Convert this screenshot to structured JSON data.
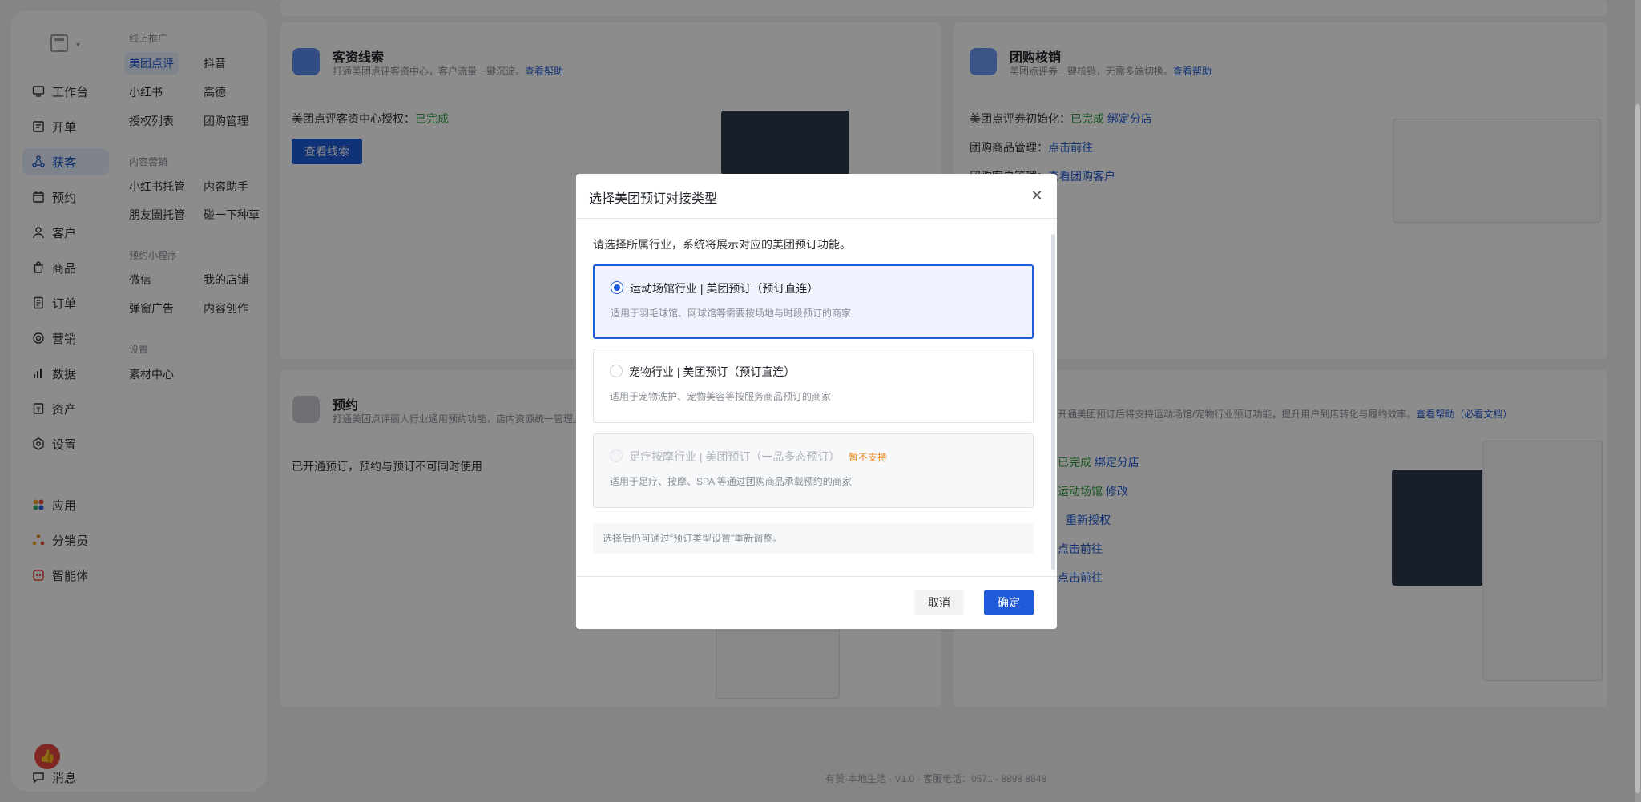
{
  "sidebar": {
    "primary": [
      {
        "label": "工作台",
        "icon": "monitor-icon"
      },
      {
        "label": "开单",
        "icon": "cashier-icon"
      },
      {
        "label": "获客",
        "icon": "share-icon"
      },
      {
        "label": "预约",
        "icon": "calendar-icon"
      },
      {
        "label": "客户",
        "icon": "user-icon"
      },
      {
        "label": "商品",
        "icon": "bag-icon"
      },
      {
        "label": "订单",
        "icon": "order-icon"
      },
      {
        "label": "营销",
        "icon": "marketing-icon"
      },
      {
        "label": "数据",
        "icon": "chart-icon"
      },
      {
        "label": "资产",
        "icon": "asset-icon"
      },
      {
        "label": "设置",
        "icon": "gear-icon"
      },
      {
        "label": "应用",
        "icon": "apps-icon"
      },
      {
        "label": "分销员",
        "icon": "distributor-icon"
      },
      {
        "label": "智能体",
        "icon": "agent-icon"
      },
      {
        "label": "消息",
        "icon": "message-icon"
      }
    ],
    "sections": [
      {
        "title": "线上推广",
        "items": [
          "美团点评",
          "抖音",
          "小红书",
          "高德",
          "授权列表",
          "团购管理"
        ]
      },
      {
        "title": "内容营销",
        "items": [
          "小红书托管",
          "内容助手",
          "朋友圈托管",
          "碰一下种草"
        ]
      },
      {
        "title": "预约小程序",
        "items": [
          "微信",
          "我的店铺",
          "弹窗广告",
          "内容创作"
        ]
      },
      {
        "title": "设置",
        "items": [
          "素材中心"
        ]
      }
    ]
  },
  "cards": {
    "leads": {
      "title": "客资线索",
      "desc": "打通美团点评客资中心，客户流量一键沉淀。",
      "help": "查看帮助",
      "auth_label": "美团点评客资中心授权：",
      "auth_status": "已完成",
      "button": "查看线索"
    },
    "groupbuy": {
      "title": "团购核销",
      "desc": "美团点评券一键核销，无需多端切换。",
      "help": "查看帮助",
      "init_label": "美团点评券初始化：",
      "init_status": "已完成",
      "init_link": "绑定分店",
      "goods_label": "团购商品管理：",
      "goods_link": "点击前往",
      "customer_label": "团购客户管理：",
      "customer_link": "查看团购客户"
    },
    "booking": {
      "title": "预约",
      "desc": "打通美团点评丽人行业通用预约功能，店内资源统一管理。",
      "note": "已开通预订，预约与预订不可同时使用"
    },
    "reserve": {
      "desc": "开通美团预订后将支持运动场馆/宠物行业预订功能，提升用户到店转化与履约效率。",
      "help": "查看帮助（必看文档）",
      "status": "已完成",
      "status_link": "绑定分店",
      "type_value": "运动场馆",
      "type_link": "修改",
      "auth_link": "重新授权",
      "link1": "点击前往",
      "link2": "点击前往"
    }
  },
  "footer": "有赞·本地生活 · V1.0 · 客服电话：0571 - 8898 8848",
  "modal": {
    "title": "选择美团预订对接类型",
    "intro": "请选择所属行业，系统将展示对应的美团预订功能。",
    "options": [
      {
        "title": "运动场馆行业 | 美团预订（预订直连）",
        "desc": "适用于羽毛球馆、网球馆等需要按场地与时段预订的商家",
        "selected": true,
        "disabled": false
      },
      {
        "title": "宠物行业 | 美团预订（预订直连）",
        "desc": "适用于宠物洗护、宠物美容等按服务商品预订的商家",
        "selected": false,
        "disabled": false
      },
      {
        "title": "足疗按摩行业 | 美团预订（一品多态预订）",
        "tag": "暂不支持",
        "desc": "适用于足疗、按摩、SPA 等通过团购商品承载预约的商家",
        "selected": false,
        "disabled": true
      }
    ],
    "hint": "选择后仍可通过“预订类型设置”重新调整。",
    "cancel": "取消",
    "confirm": "确定"
  },
  "colors": {
    "primary": "#1e5bd8",
    "success": "#2e9e3c",
    "warning": "#e8891d",
    "overlay": "rgba(0,0,0,0.45)"
  }
}
